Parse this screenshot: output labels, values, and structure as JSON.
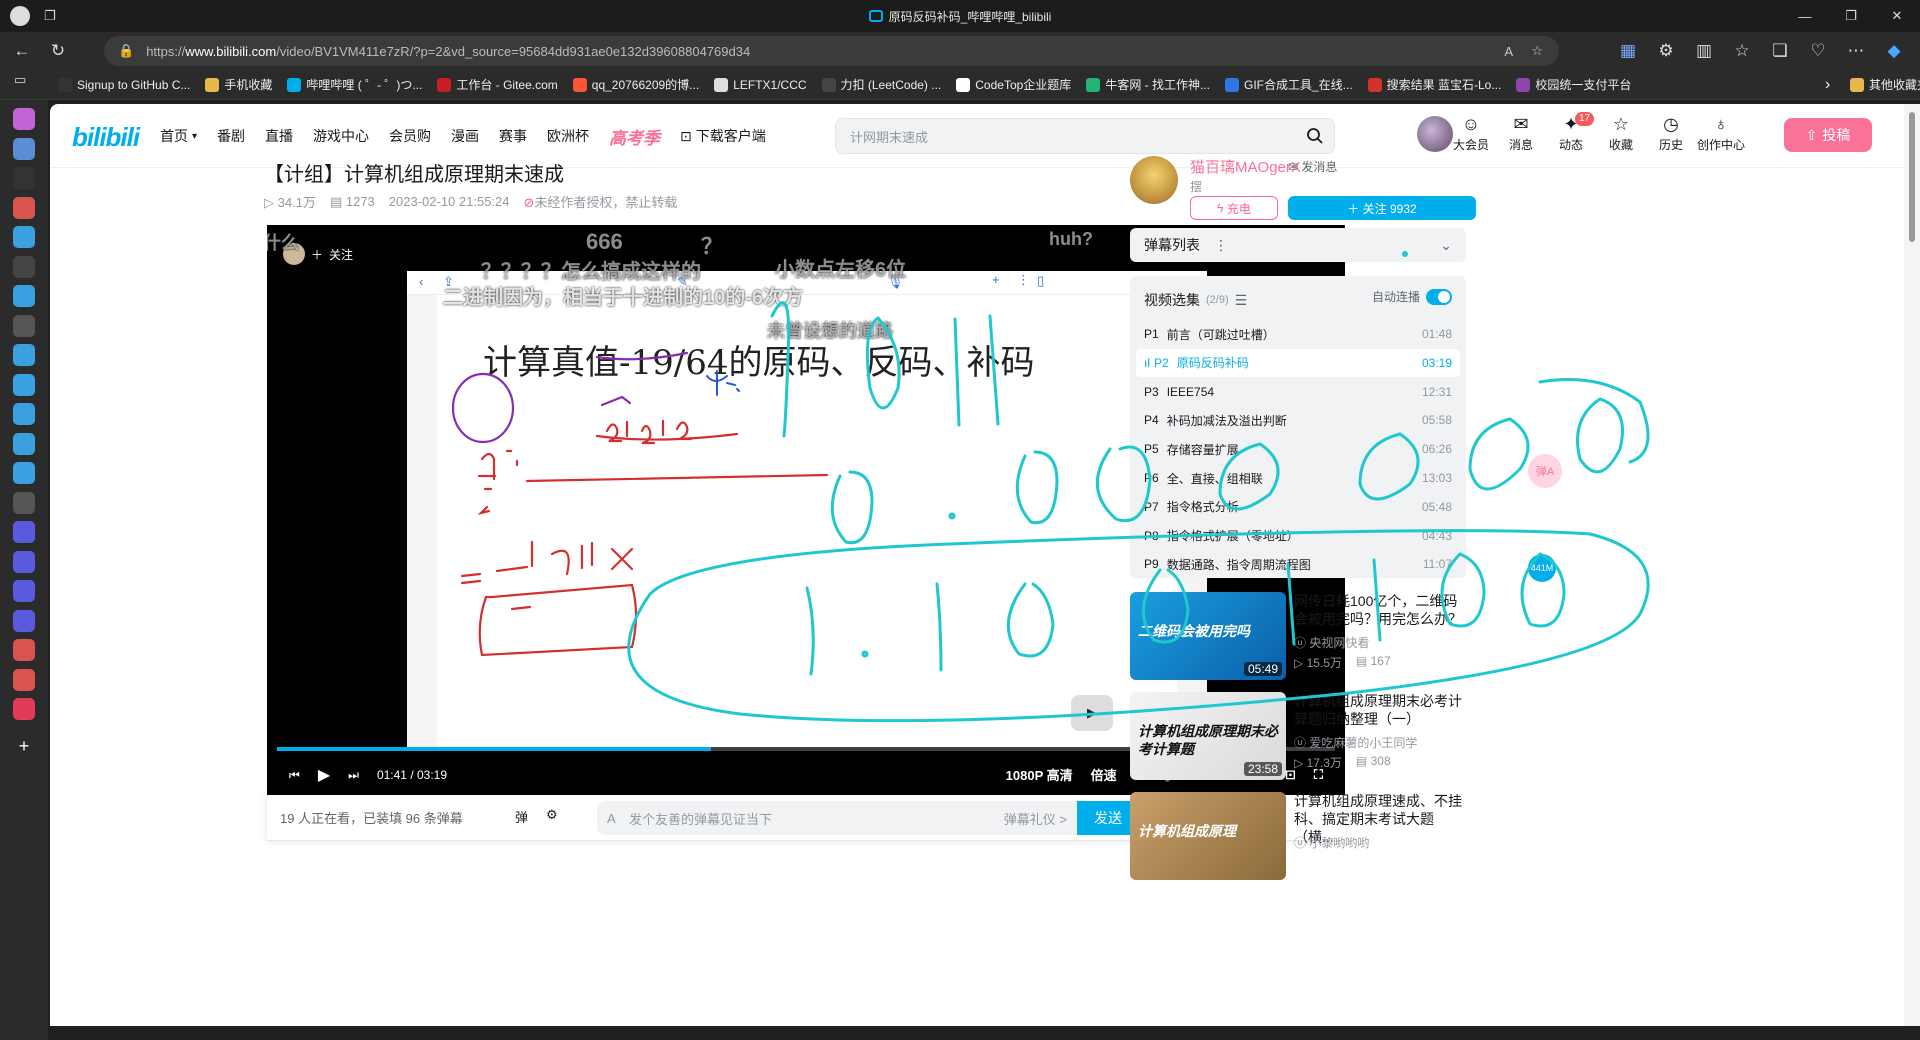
{
  "browser": {
    "tab_title": "原码反码补码_哔哩哔哩_bilibili",
    "url_prefix": "https://",
    "url_host": "www.bilibili.com",
    "url_path": "/video/BV1VM411e7zR/?p=2&vd_source=95684dd931ae0e132d39608804769d34",
    "read_aloud": "A",
    "bookmarks": [
      {
        "label": "Signup to GitHub C...",
        "color": "#333333"
      },
      {
        "label": "手机收藏",
        "color": "#e8b84a"
      },
      {
        "label": "哔哩哔哩 ( ゜- ゜)つ...",
        "color": "#00aeec"
      },
      {
        "label": "工作台 - Gitee.com",
        "color": "#c71d23"
      },
      {
        "label": "qq_20766209的博...",
        "color": "#fc5531"
      },
      {
        "label": "LEFTX1/CCC",
        "color": "#dddddd"
      },
      {
        "label": "力扣 (LeetCode) ...",
        "color": "#444444"
      },
      {
        "label": "CodeTop企业题库",
        "color": "#ffffff"
      },
      {
        "label": "牛客网 - 找工作神...",
        "color": "#22b573"
      },
      {
        "label": "GIF合成工具_在线...",
        "color": "#2b78e4"
      },
      {
        "label": "搜索结果 蓝宝石-Lo...",
        "color": "#d2312d"
      },
      {
        "label": "校园统一支付平台",
        "color": "#8e44ad"
      }
    ],
    "bookmarks_other": "其他收藏夹"
  },
  "header": {
    "nav": [
      "首页",
      "番剧",
      "直播",
      "游戏中心",
      "会员购",
      "漫画",
      "赛事",
      "欧洲杯"
    ],
    "highlight": "高考季",
    "download": "下载客户端",
    "search_placeholder": "计网期末速成",
    "icons": [
      {
        "label": "大会员",
        "icon": "vip-icon"
      },
      {
        "label": "消息",
        "icon": "mail-icon"
      },
      {
        "label": "动态",
        "icon": "dynamic-icon",
        "badge": "17"
      },
      {
        "label": "收藏",
        "icon": "star-icon"
      },
      {
        "label": "历史",
        "icon": "clock-icon"
      },
      {
        "label": "创作中心",
        "icon": "bulb-icon"
      }
    ],
    "upload": "投稿"
  },
  "video": {
    "title": "【计组】计算机组成原理期末速成",
    "views": "34.1万",
    "danmaku_count": "1273",
    "date": "2023-02-10 21:55:24",
    "copyright": "未经作者授权，禁止转载"
  },
  "player": {
    "follow": "关注",
    "slide_title": "计算真值-19/64的原码、反码、补码",
    "time_current": "01:41",
    "time_sep": "/",
    "time_total": "03:19",
    "progress_fraction": 0.41,
    "quality": "1080P 高清",
    "speed": "倍速",
    "danmaku": [
      "什么",
      "666",
      "？",
      "huh?",
      "？？？？怎么搞成这样的",
      "小数点左移6位",
      "二进制因为，相当于十进制的10的-6次方",
      "未曾设想的道路"
    ]
  },
  "danmaku_bar": {
    "watching": "19 人正在看，已装填 96 条弹幕",
    "placeholder": "发个友善的弹幕见证当下",
    "etiquette": "弹幕礼仪 >",
    "send": "发送"
  },
  "uploader": {
    "name": "猫百璃MAOgerX",
    "message": "发消息",
    "desc": "摆",
    "charge": "充电",
    "follow": "关注 9932"
  },
  "dm_list": {
    "label": "弹幕列表"
  },
  "playlist": {
    "title": "视频选集",
    "count": "(2/9)",
    "autoplay": "自动连播",
    "items": [
      {
        "p": "P1",
        "title": "前言（可跳过吐槽）",
        "dur": "01:48"
      },
      {
        "p": "P2",
        "title": "原码反码补码",
        "dur": "03:19"
      },
      {
        "p": "P3",
        "title": "IEEE754",
        "dur": "12:31"
      },
      {
        "p": "P4",
        "title": "补码加减法及溢出判断",
        "dur": "05:58"
      },
      {
        "p": "P5",
        "title": "存储容量扩展",
        "dur": "06:26"
      },
      {
        "p": "P6",
        "title": "全、直接、组相联",
        "dur": "13:03"
      },
      {
        "p": "P7",
        "title": "指令格式分析",
        "dur": "05:48"
      },
      {
        "p": "P8",
        "title": "指令格式扩展（零地址）",
        "dur": "04:43"
      },
      {
        "p": "P9",
        "title": "数据通路、指令周期流程图",
        "dur": "11:07"
      }
    ]
  },
  "recommendations": [
    {
      "title": "网传日耗100亿个，二维码会被用完吗？用完怎么办？",
      "author": "央视网快看",
      "views": "15.5万",
      "dm": "167",
      "dur": "05:49",
      "thumb_text": "二维码会被用完吗"
    },
    {
      "title": "计算机组成原理期末必考计算题归纳整理（一）",
      "author": "爱吃麻薯的小王同学",
      "views": "17.3万",
      "dm": "308",
      "dur": "23:58",
      "thumb_text": "计算机组成原理期末必考计算题"
    },
    {
      "title": "计算机组成原理速成、不挂科、搞定期末考试大题（横...",
      "author": "小黎哟哟哟",
      "views": "",
      "dm": "",
      "dur": "",
      "thumb_text": "计算机组成原理"
    }
  ],
  "floats": {
    "a": "弹A",
    "b": "441M"
  }
}
